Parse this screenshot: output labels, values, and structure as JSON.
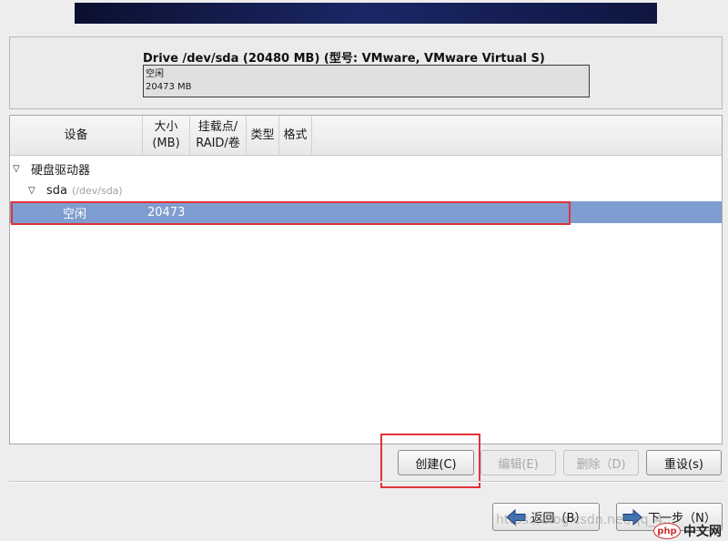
{
  "drive": {
    "title": "Drive /dev/sda (20480 MB) (型号: VMware, VMware Virtual S)",
    "bar_label": "空闲",
    "bar_size": "20473 MB"
  },
  "columns": [
    {
      "label": "设备"
    },
    {
      "label": "大小\n(MB)"
    },
    {
      "label": "挂载点/\nRAID/卷"
    },
    {
      "label": "类型"
    },
    {
      "label": "格式"
    }
  ],
  "tree": {
    "group_label": "硬盘驱动器",
    "disk_label": "sda",
    "disk_path": "(/dev/sda)",
    "free_label": "空闲",
    "free_size": "20473"
  },
  "buttons": {
    "create": "创建(C)",
    "edit": "编辑(E)",
    "delete": "删除（D)",
    "reset": "重设(s)",
    "back": "返回（B）",
    "next": "下一步（N）"
  },
  "watermark": {
    "text": "https://blog.csdn.net/qq_4…",
    "logo_oval": "php",
    "logo_text": "中文网"
  },
  "colors": {
    "selection": "#7f9dd0",
    "highlight": "#e0343a"
  }
}
